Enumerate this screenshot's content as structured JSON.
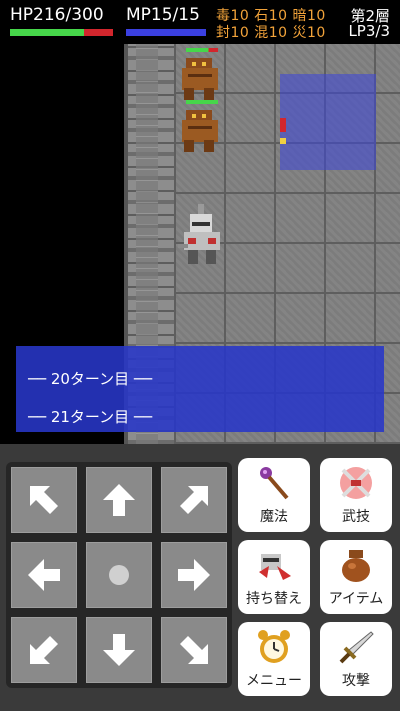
{
  "hud": {
    "hp": "HP216/300",
    "mp": "MP15/15",
    "hp_fraction": 0.72,
    "mp_fraction": 1.0,
    "status_line1": "毒10 石10 暗10",
    "status_line2": "封10 混10 災10",
    "floor": "第2層",
    "lp": "LP3/3"
  },
  "log": {
    "line1": "── 20ターン目 ──",
    "line2": "── 21ターン目 ──"
  },
  "dpad": {
    "icons": [
      "arrow-up-left",
      "arrow-up",
      "arrow-up-right",
      "arrow-left",
      "wait-dot",
      "arrow-right",
      "arrow-down-left",
      "arrow-down",
      "arrow-down-right"
    ]
  },
  "actions": {
    "magic": "魔法",
    "skill": "武技",
    "swap": "持ち替え",
    "item": "アイテム",
    "menu": "メニュー",
    "attack": "攻撃"
  },
  "colors": {
    "status_text": "#f2a33a",
    "hp_green": "#46d64a",
    "hp_red": "#d2262d",
    "mp_blue": "#3b40e0",
    "log_bg": "#2837c8"
  }
}
